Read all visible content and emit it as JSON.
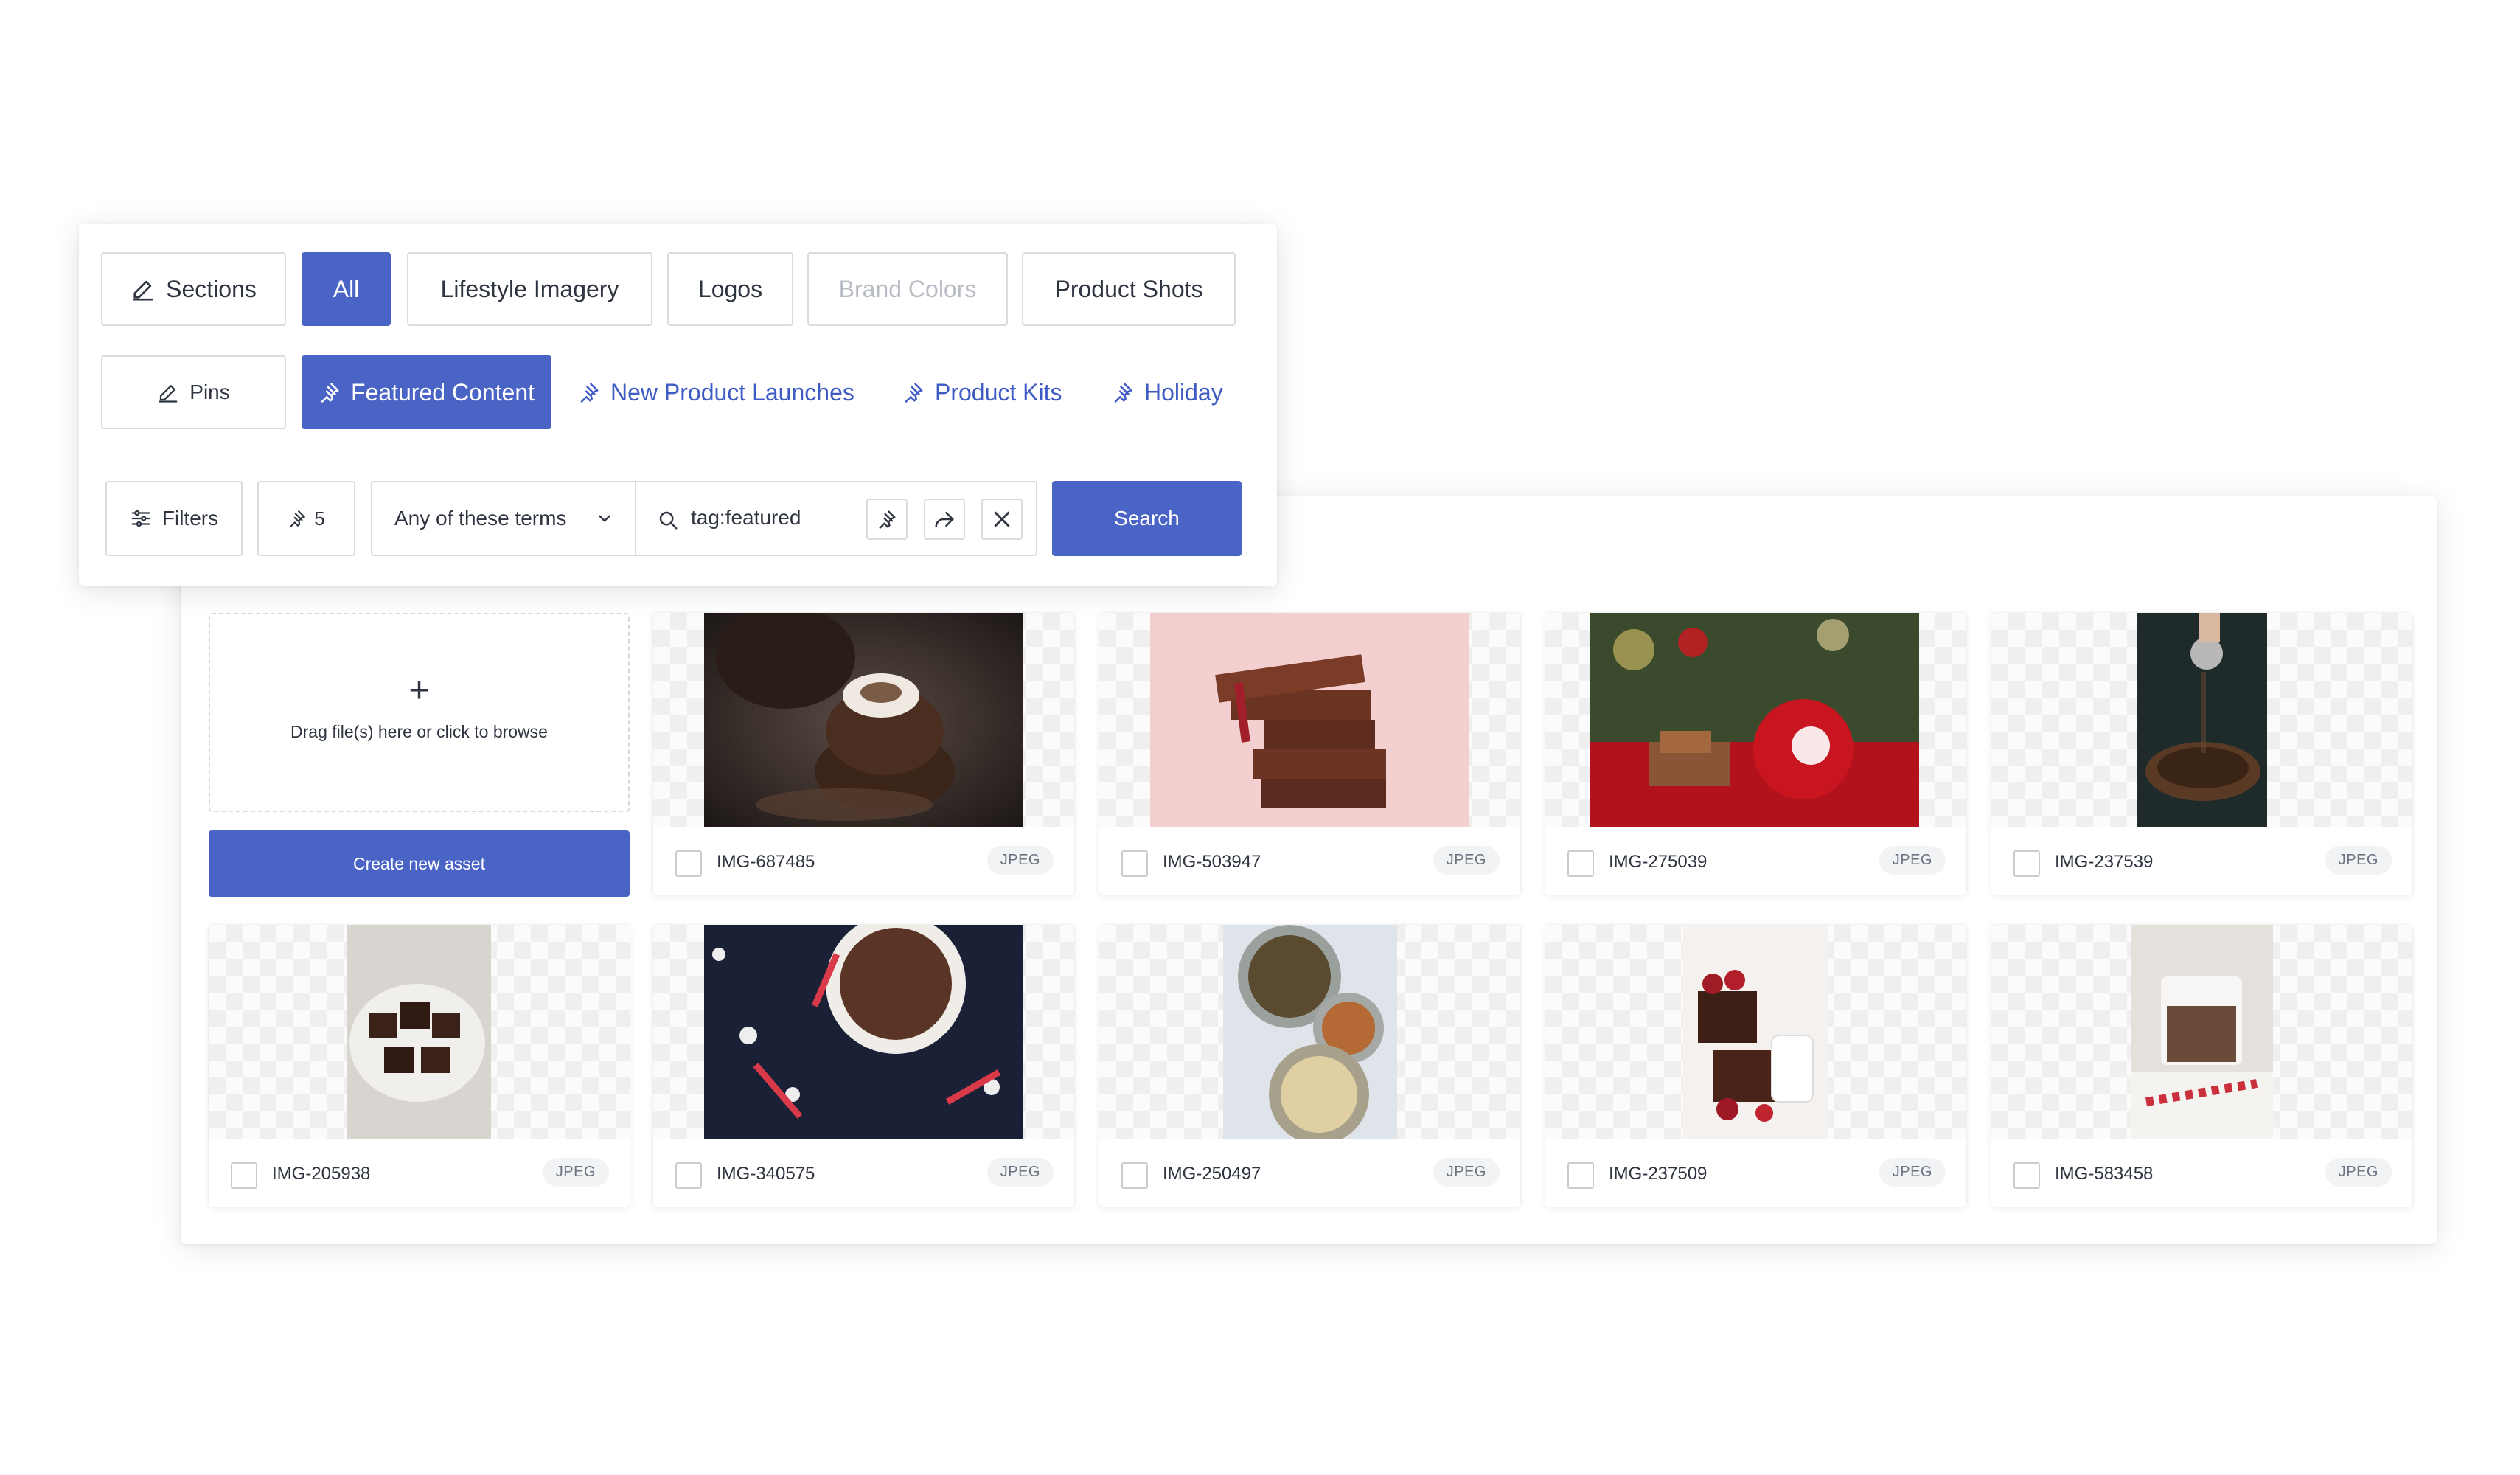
{
  "sections": {
    "edit_label": "Sections",
    "tabs": [
      {
        "label": "All",
        "active": true
      },
      {
        "label": "Lifestyle Imagery"
      },
      {
        "label": "Logos"
      },
      {
        "label": "Brand Colors",
        "disabled": true
      },
      {
        "label": "Product Shots"
      }
    ]
  },
  "pins": {
    "edit_label": "Pins",
    "items": [
      {
        "label": "Featured Content",
        "active": true
      },
      {
        "label": "New Product Launches"
      },
      {
        "label": "Product Kits"
      },
      {
        "label": "Holiday"
      }
    ]
  },
  "search": {
    "filters_label": "Filters",
    "pin_count": "5",
    "match_mode": "Any of these terms",
    "query": "tag:featured",
    "submit_label": "Search"
  },
  "upload": {
    "plus": "+",
    "drop_text": "Drag file(s) here or click to browse",
    "create_label": "Create new asset"
  },
  "assets": [
    {
      "name": "IMG-687485",
      "type": "JPEG"
    },
    {
      "name": "IMG-503947",
      "type": "JPEG"
    },
    {
      "name": "IMG-275039",
      "type": "JPEG"
    },
    {
      "name": "IMG-237539",
      "type": "JPEG"
    },
    {
      "name": "IMG-205938",
      "type": "JPEG"
    },
    {
      "name": "IMG-340575",
      "type": "JPEG"
    },
    {
      "name": "IMG-250497",
      "type": "JPEG"
    },
    {
      "name": "IMG-237509",
      "type": "JPEG"
    },
    {
      "name": "IMG-583458",
      "type": "JPEG"
    }
  ],
  "colors": {
    "accent": "#4a64c6",
    "link": "#3f5bc4",
    "border": "#d8dbe0"
  }
}
